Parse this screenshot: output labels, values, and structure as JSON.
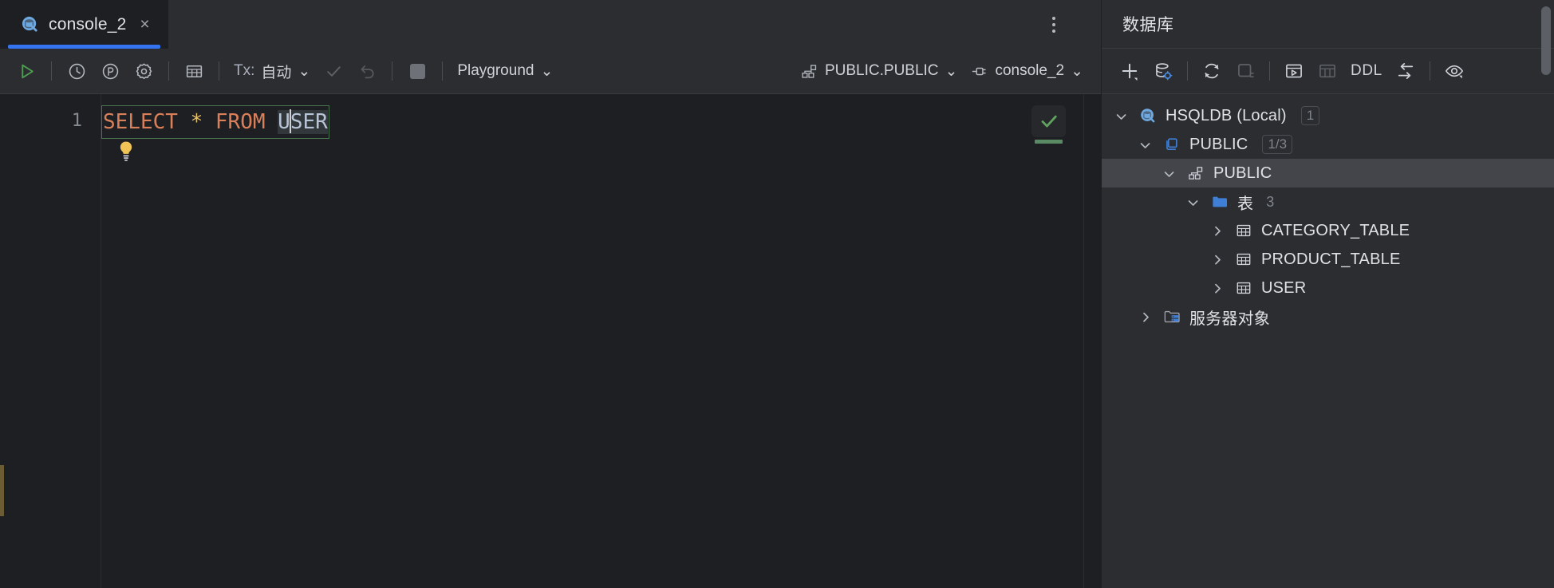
{
  "window": {
    "theme_bg": "#1e1f22",
    "panel_bg": "#2b2d30",
    "accent": "#3574f0"
  },
  "tabs": {
    "items": [
      {
        "label": "console_2",
        "icon": "database-console-icon",
        "active": true,
        "close_label": "×"
      }
    ],
    "overflow_menu_name": "more-options-icon"
  },
  "console_toolbar": {
    "execute_icon": "run-play-icon",
    "history_icon": "history-clock-icon",
    "parameters_icon": "parameters-circle-p-icon",
    "settings_icon": "gear-icon",
    "table_icon": "table-grid-icon",
    "tx_prefix": "Tx:",
    "tx_value": "自动",
    "tx_chevron": "⌄",
    "commit_icon": "commit-check-icon",
    "rollback_icon": "rollback-revert-icon",
    "stop_icon": "stop-square-icon",
    "session_label": "Playground",
    "session_chevron": "⌄",
    "schema_icon": "schema-nodes-icon",
    "schema_label": "PUBLIC.PUBLIC",
    "schema_chevron": "⌄",
    "connection_icon": "plug-connection-icon",
    "connection_label": "console_2",
    "connection_chevron": "⌄"
  },
  "editor": {
    "line_number": "1",
    "code": {
      "keyword1": "SELECT",
      "star": "*",
      "keyword2": "FROM",
      "identifier_before_caret": "U",
      "identifier_after_caret": "SER",
      "full_text": "SELECT * FROM USER"
    },
    "intention_bulb_icon": "lightbulb-intention-icon",
    "inspection_icon": "inspection-ok-check-icon"
  },
  "database_panel": {
    "title": "数据库",
    "toolbar": {
      "add_icon": "add-plus-icon",
      "datasource_properties_icon": "datasource-properties-icon",
      "refresh_icon": "refresh-sync-icon",
      "stop_refresh_icon": "stop-refresh-icon",
      "open_console_icon": "open-console-icon",
      "data_editor_icon": "table-data-editor-icon",
      "ddl_label": "DDL",
      "jump_to_editor_icon": "jump-to-query-console-icon",
      "preview_icon": "preview-eye-icon"
    },
    "tree": [
      {
        "label": "HSQLDB (Local)",
        "icon": "database-console-icon",
        "badge": "1",
        "indent": 0,
        "twisty": "expanded",
        "selected": false
      },
      {
        "label": "PUBLIC",
        "icon": "database-stack-icon",
        "badge": "1/3",
        "indent": 1,
        "twisty": "expanded",
        "selected": false
      },
      {
        "label": "PUBLIC",
        "icon": "schema-nodes-icon",
        "badge": "",
        "indent": 2,
        "twisty": "expanded",
        "selected": true
      },
      {
        "label": "表",
        "icon": "folder-icon",
        "count": "3",
        "indent": 3,
        "twisty": "expanded",
        "selected": false
      },
      {
        "label": "CATEGORY_TABLE",
        "icon": "table-grid-icon",
        "badge": "",
        "indent": 4,
        "twisty": "collapsed",
        "selected": false
      },
      {
        "label": "PRODUCT_TABLE",
        "icon": "table-grid-icon",
        "badge": "",
        "indent": 4,
        "twisty": "collapsed",
        "selected": false
      },
      {
        "label": "USER",
        "icon": "table-grid-icon",
        "badge": "",
        "indent": 4,
        "twisty": "collapsed",
        "selected": false
      },
      {
        "label": "服务器对象",
        "icon": "folder-server-icon",
        "badge": "",
        "indent": 1,
        "twisty": "collapsed",
        "selected": false
      }
    ]
  }
}
